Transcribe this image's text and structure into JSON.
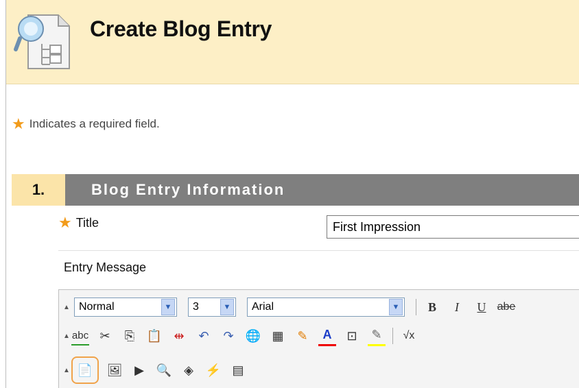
{
  "page": {
    "title": "Create Blog Entry"
  },
  "required_note": "Indicates a required field.",
  "section": {
    "number": "1.",
    "title": "Blog Entry Information"
  },
  "fields": {
    "title_label": "Title",
    "title_value": "First Impression",
    "entry_message_label": "Entry Message"
  },
  "toolbar": {
    "format_value": "Normal",
    "size_value": "3",
    "font_value": "Arial",
    "bold_glyph": "B",
    "italic_glyph": "I",
    "underline_glyph": "U",
    "strike_glyph": "abe",
    "spellcheck_glyph": "abc",
    "font_color_glyph": "A",
    "math_glyph": "√x"
  },
  "colors": {
    "header_bg": "#fdefc6",
    "section_bar": "#7f7f7f",
    "section_number_bg": "#fbe4a9",
    "required_star": "#f29b1a",
    "highlight_ring": "#f0a34a"
  }
}
